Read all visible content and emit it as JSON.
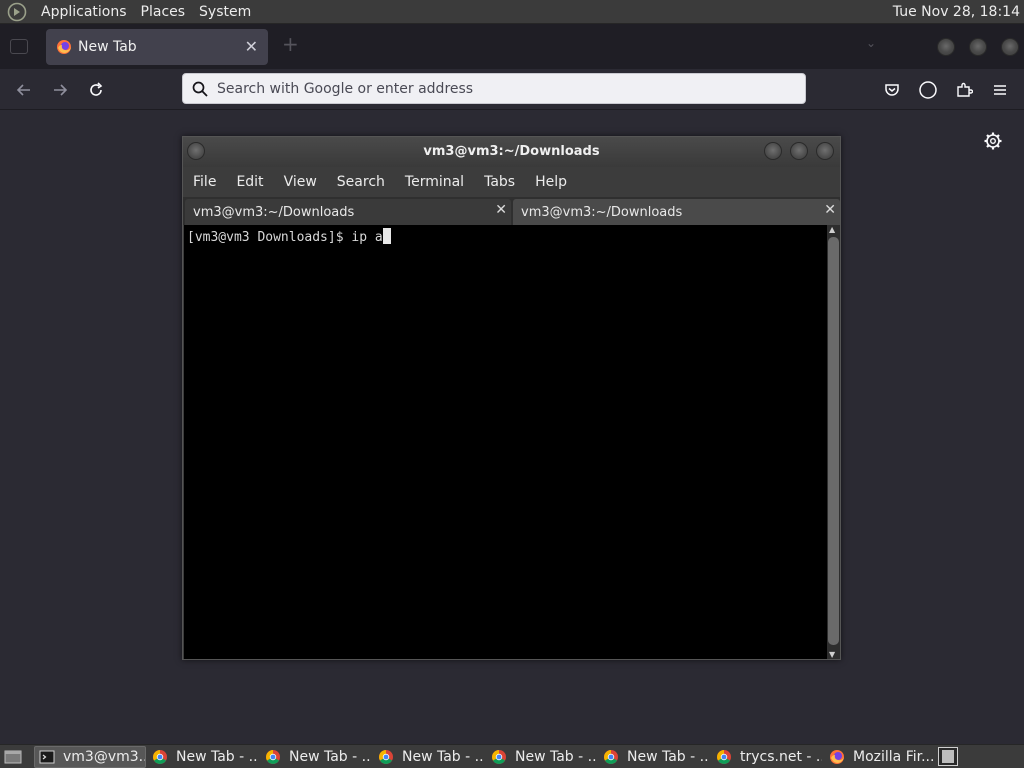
{
  "top_panel": {
    "menu": [
      "Applications",
      "Places",
      "System"
    ],
    "clock": "Tue Nov 28, 18:14"
  },
  "firefox": {
    "tab": {
      "title": "New Tab"
    },
    "urlbar": {
      "placeholder": "Search with Google or enter address"
    }
  },
  "terminal": {
    "title": "vm3@vm3:~/Downloads",
    "menu": [
      "File",
      "Edit",
      "View",
      "Search",
      "Terminal",
      "Tabs",
      "Help"
    ],
    "tabs": [
      "vm3@vm3:~/Downloads",
      "vm3@vm3:~/Downloads"
    ],
    "prompt": "[vm3@vm3 Downloads]$ ",
    "command": "ip a"
  },
  "taskbar": {
    "tasks": [
      {
        "label": "vm3@vm3...",
        "icon": "terminal-icon",
        "active": true
      },
      {
        "label": "New Tab - ...",
        "icon": "chrome-icon"
      },
      {
        "label": "New Tab - ...",
        "icon": "chrome-icon"
      },
      {
        "label": "New Tab - ...",
        "icon": "chrome-icon"
      },
      {
        "label": "New Tab - ...",
        "icon": "chrome-icon"
      },
      {
        "label": "New Tab - ...",
        "icon": "chrome-icon"
      },
      {
        "label": "trycs.net - ...",
        "icon": "chrome-icon"
      },
      {
        "label": "Mozilla Fir...",
        "icon": "firefox-icon"
      }
    ]
  },
  "colors": {
    "panel": "#3b3b3b",
    "firefox_bg": "#2b2a33",
    "terminal_bg": "#000000",
    "urlbar_bg": "#f0f0f4"
  }
}
